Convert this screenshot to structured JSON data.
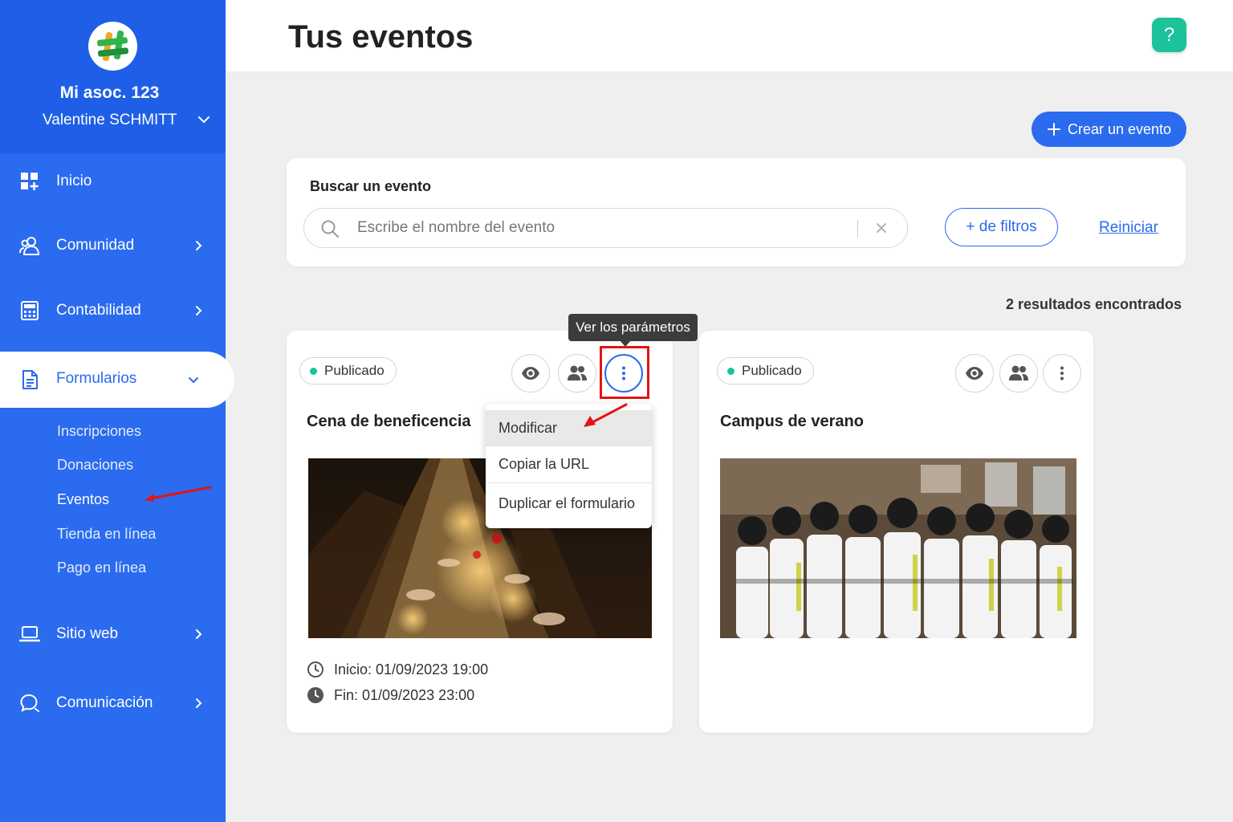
{
  "sidebar": {
    "org_name": "Mi asoc. 123",
    "user_name": "Valentine SCHMITT",
    "items": [
      {
        "label": "Inicio",
        "icon": "dashboard-icon"
      },
      {
        "label": "Comunidad",
        "icon": "users-icon"
      },
      {
        "label": "Contabilidad",
        "icon": "calculator-icon"
      },
      {
        "label": "Formularios",
        "icon": "document-icon"
      },
      {
        "label": "Sitio web",
        "icon": "laptop-icon"
      },
      {
        "label": "Comunicación",
        "icon": "chat-icon"
      }
    ],
    "subitems": [
      "Inscripciones",
      "Donaciones",
      "Eventos",
      "Tienda en línea",
      "Pago en línea"
    ],
    "current_subitem": "Eventos"
  },
  "header": {
    "title": "Tus eventos",
    "help_label": "?"
  },
  "toolbar": {
    "create_label": "Crear un evento"
  },
  "search": {
    "title": "Buscar un evento",
    "placeholder": "Escribe el nombre del evento",
    "filters_label": "+ de filtros",
    "reset_label": "Reiniciar"
  },
  "results_text": "2 resultados encontrados",
  "events": [
    {
      "status": "Publicado",
      "title": "Cena de beneficencia",
      "start": "Inicio: 01/09/2023 19:00",
      "end": "Fin: 01/09/2023 23:00",
      "image": "dinner-table-photo"
    },
    {
      "status": "Publicado",
      "title": "Campus de verano",
      "image": "basketball-team-photo"
    }
  ],
  "tooltip": "Ver los parámetros",
  "menu": {
    "items": [
      "Modificar",
      "Copiar la URL",
      "Duplicar el formulario"
    ],
    "highlighted": "Modificar"
  },
  "colors": {
    "primary": "#2a6bef",
    "sidebar_head": "#1f5fe8",
    "success": "#1cc29a",
    "annotation": "#e31414"
  }
}
